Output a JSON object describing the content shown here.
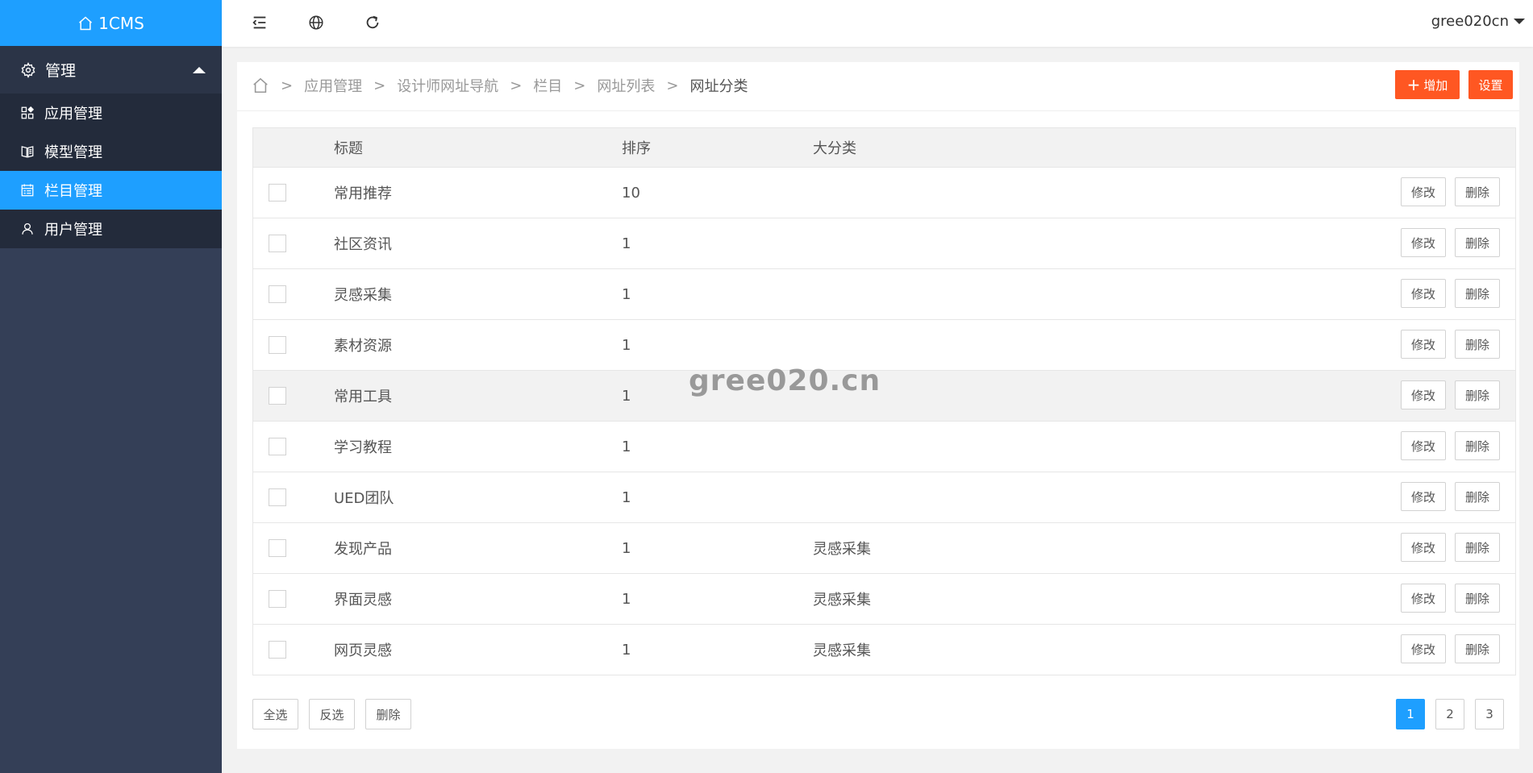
{
  "sidebar": {
    "logo": "1CMS",
    "group_label": "管理",
    "items": [
      {
        "label": "应用管理"
      },
      {
        "label": "模型管理"
      },
      {
        "label": "栏目管理",
        "active": true
      },
      {
        "label": "用户管理"
      }
    ]
  },
  "topbar": {
    "icons": [
      "menu-fold-icon",
      "globe-icon",
      "refresh-icon"
    ],
    "user": "gree020cn"
  },
  "breadcrumb": {
    "items": [
      "应用管理",
      "设计师网址导航",
      "栏目",
      "网址列表"
    ],
    "current": "网址分类"
  },
  "actions": {
    "add_label": "增加",
    "settings_label": "设置"
  },
  "table": {
    "headers": {
      "title": "标题",
      "sort": "排序",
      "category": "大分类"
    },
    "rows": [
      {
        "title": "常用推荐",
        "sort": "10",
        "category": ""
      },
      {
        "title": "社区资讯",
        "sort": "1",
        "category": ""
      },
      {
        "title": "灵感采集",
        "sort": "1",
        "category": ""
      },
      {
        "title": "素材资源",
        "sort": "1",
        "category": ""
      },
      {
        "title": "常用工具",
        "sort": "1",
        "category": ""
      },
      {
        "title": "学习教程",
        "sort": "1",
        "category": ""
      },
      {
        "title": "UED团队",
        "sort": "1",
        "category": ""
      },
      {
        "title": "发现产品",
        "sort": "1",
        "category": "灵感采集"
      },
      {
        "title": "界面灵感",
        "sort": "1",
        "category": "灵感采集"
      },
      {
        "title": "网页灵感",
        "sort": "1",
        "category": "灵感采集"
      }
    ],
    "edit_label": "修改",
    "delete_label": "删除"
  },
  "footer": {
    "select_all": "全选",
    "invert": "反选",
    "delete": "删除"
  },
  "pagination": {
    "pages": [
      "1",
      "2",
      "3"
    ],
    "current": "1"
  },
  "watermark": "gree020.cn",
  "colors": {
    "accent": "#1e9fff",
    "danger": "#ff5722",
    "sidebar": "#343f57",
    "sidebar_menu": "#232b3b"
  }
}
